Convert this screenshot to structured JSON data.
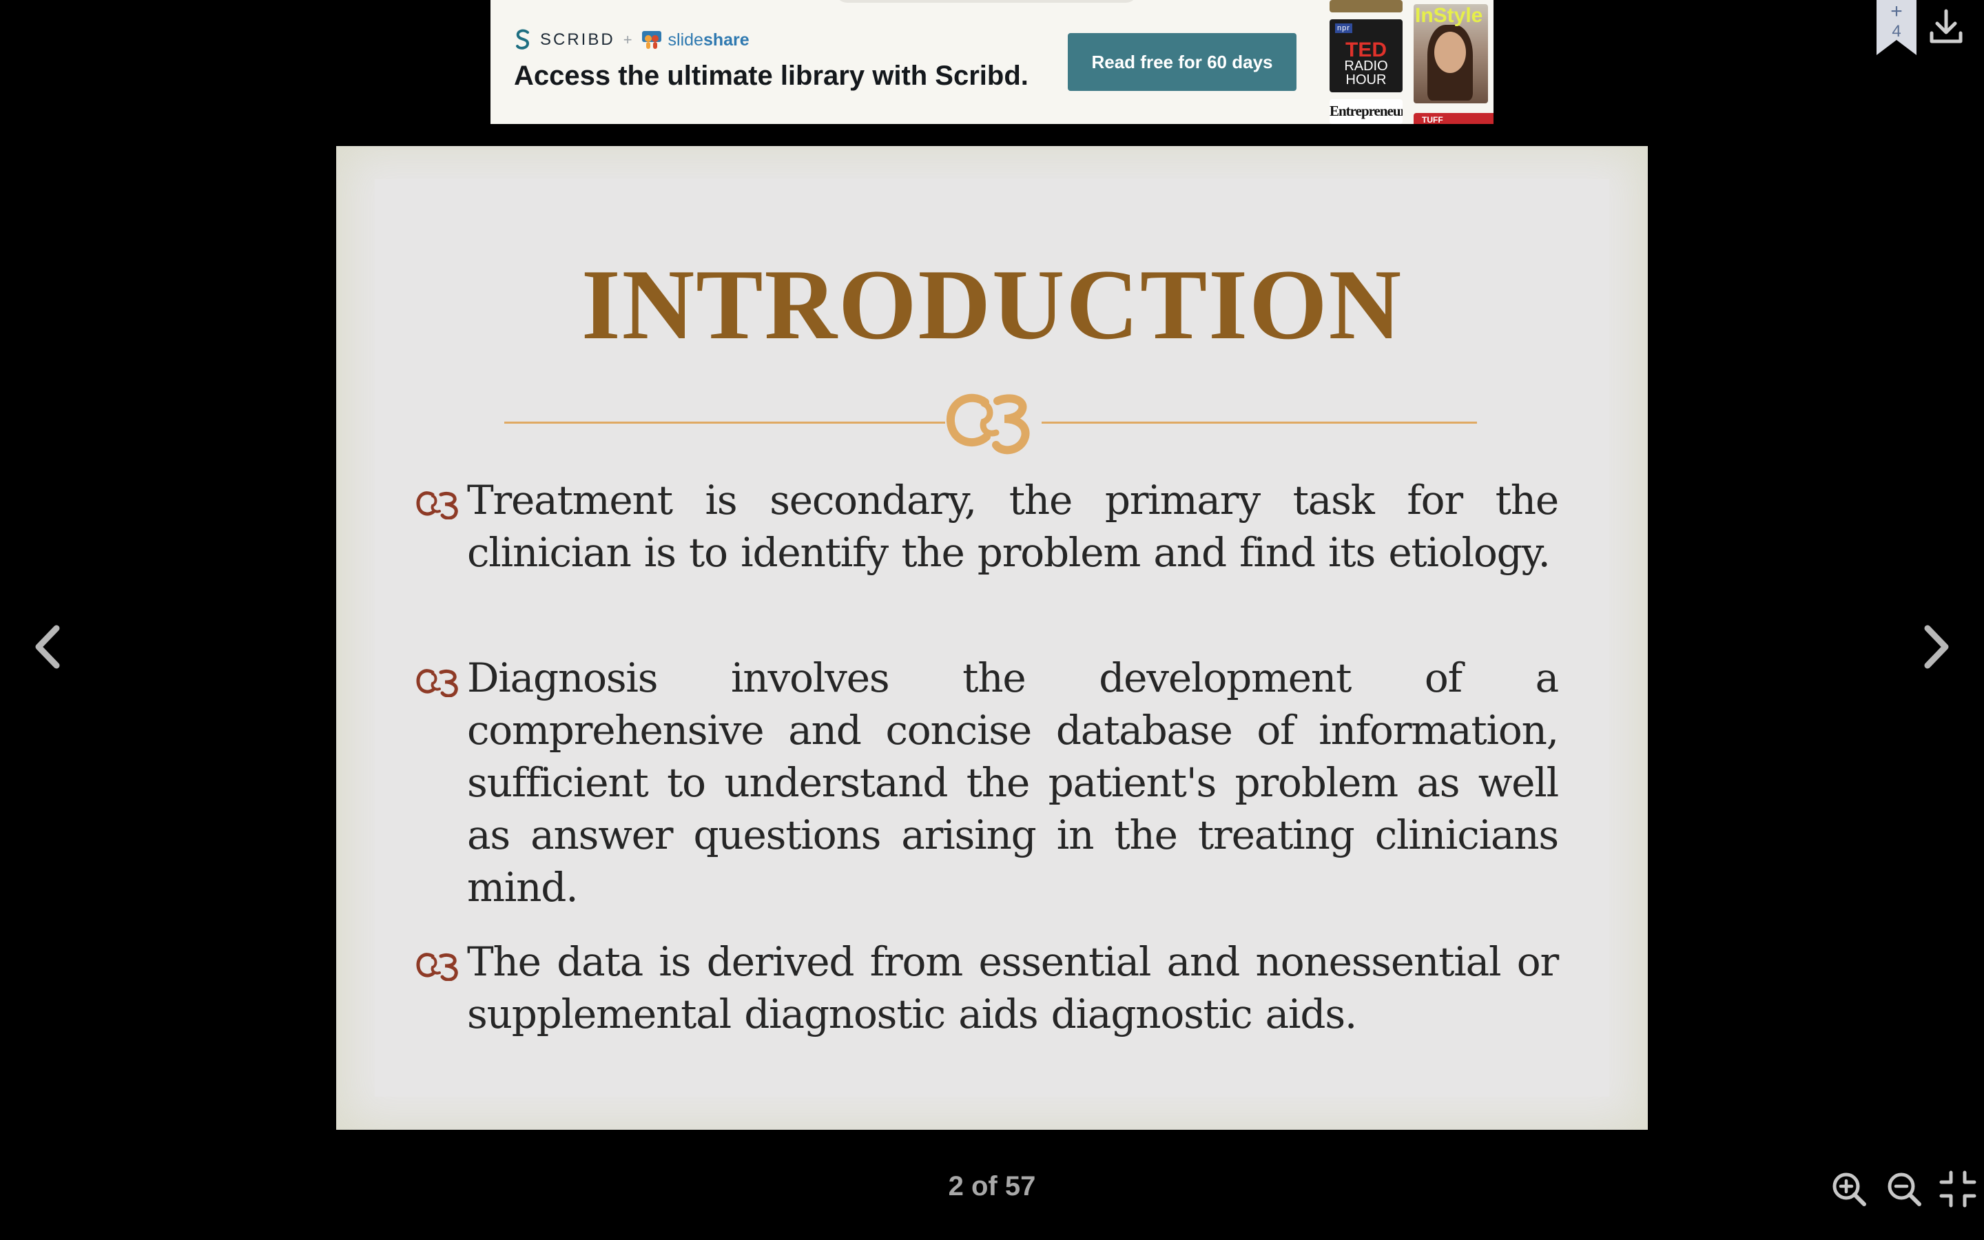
{
  "ad": {
    "scribd_label": "SCRIBD",
    "plus": "+",
    "slideshare_prefix": "slide",
    "slideshare_suffix": "share",
    "tagline": "Access the ultimate library with Scribd.",
    "cta_label": "Read free for 60 days",
    "book_npr": "npr",
    "book_ted_title": "TED",
    "book_ted_line1": "RADIO",
    "book_ted_line2": "HOUR",
    "book_entrepreneur": "Entrepreneur",
    "book_instyle": "InStyle",
    "book_tuff": "TUFF"
  },
  "bookmark": {
    "plus": "+",
    "count": "4"
  },
  "slide": {
    "title": "INTRODUCTION",
    "bullets": [
      "Treatment is secondary, the primary task for the clinician is to identify the problem and find its etiology.",
      "Diagnosis involves the development of a comprehensive and concise database of information, sufficient to understand the patient's problem as well as answer questions arising in the treating clinicians mind.",
      "The data is derived from essential and nonessential or supplemental diagnostic aids diagnostic aids."
    ]
  },
  "pager": {
    "label": "2 of 57"
  },
  "colors": {
    "title": "#8d5e20",
    "ornament": "#dfa963",
    "bullet_mark": "#8e3a26",
    "cta": "#3f7a86"
  },
  "icons": {
    "prev": "chevron-left-icon",
    "next": "chevron-right-icon",
    "download": "download-icon",
    "bookmark": "bookmark-icon",
    "zoom_in": "zoom-in-icon",
    "zoom_out": "zoom-out-icon",
    "exit_fullscreen": "exit-fullscreen-icon"
  }
}
